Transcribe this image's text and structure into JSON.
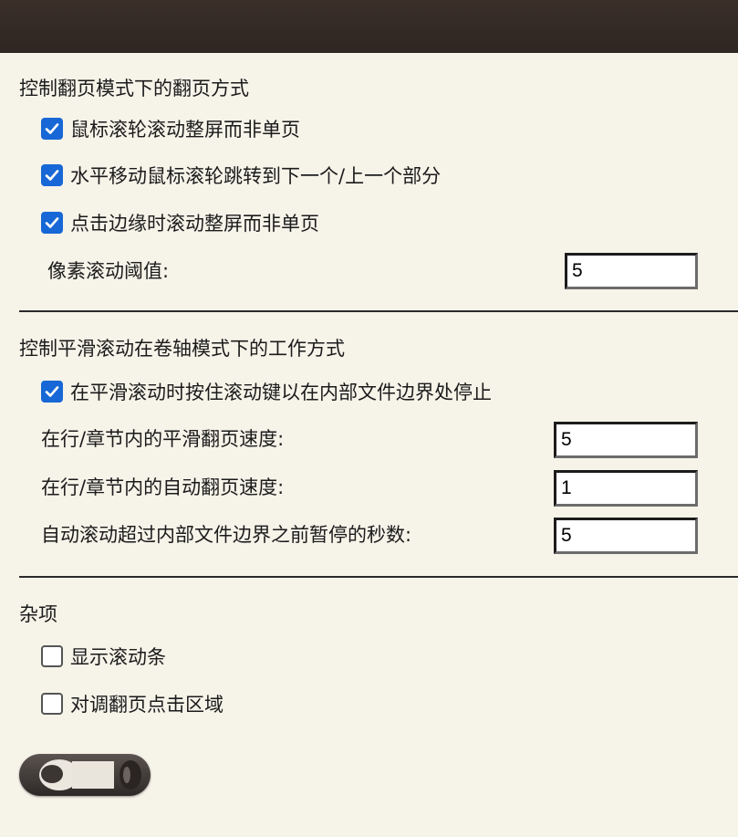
{
  "page_turn_section": {
    "title": "控制翻页模式下的翻页方式",
    "options": [
      {
        "label": "鼠标滚轮滚动整屏而非单页",
        "checked": true
      },
      {
        "label": "水平移动鼠标滚轮跳转到下一个/上一个部分",
        "checked": true
      },
      {
        "label": "点击边缘时滚动整屏而非单页",
        "checked": true
      }
    ],
    "pixel_threshold": {
      "label": "像素滚动阈值:",
      "value": "5"
    }
  },
  "smooth_scroll_section": {
    "title": "控制平滑滚动在卷轴模式下的工作方式",
    "options": [
      {
        "label": "在平滑滚动时按住滚动键以在内部文件边界处停止",
        "checked": true
      }
    ],
    "fields": [
      {
        "label": "在行/章节内的平滑翻页速度:",
        "value": "5"
      },
      {
        "label": "在行/章节内的自动翻页速度:",
        "value": "1"
      },
      {
        "label": "自动滚动超过内部文件边界之前暂停的秒数:",
        "value": "5"
      }
    ]
  },
  "misc_section": {
    "title": "杂项",
    "options": [
      {
        "label": "显示滚动条",
        "checked": false
      },
      {
        "label": "对调翻页点击区域",
        "checked": false
      }
    ]
  },
  "colors": {
    "background": "#f6f3e9",
    "titlebar": "#342a25",
    "checkbox_accent": "#1768d6"
  },
  "icons": {
    "check": "checkmark-icon",
    "toggle": "toggle-switch-icon"
  }
}
